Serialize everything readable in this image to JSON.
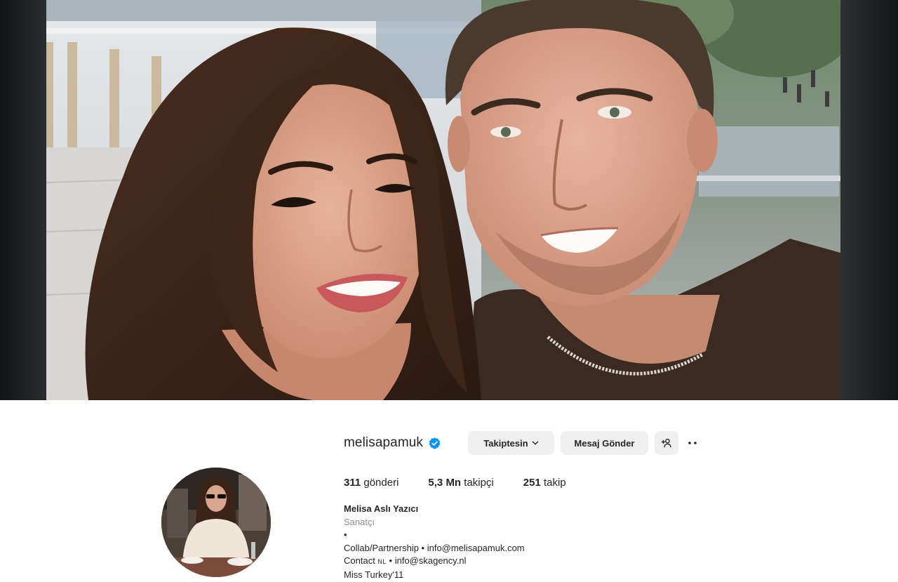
{
  "profile": {
    "username": "melisapamuk",
    "verified_icon": "verified-badge-icon",
    "follow_button_label": "Takiptesin",
    "message_button_label": "Mesaj Gönder",
    "add_user_icon": "add-user-icon",
    "more_icon": "more-options-icon",
    "stats": {
      "posts_count": "311",
      "posts_label": " gönderi",
      "followers_count": "5,3 Mn",
      "followers_label": " takipçi",
      "following_count": "251",
      "following_label": " takip"
    },
    "bio": {
      "full_name": "Melisa Aslı Yazıcı",
      "category": "Sanatçı",
      "bullet": "•",
      "line_collab": "Collab/Partnership • info@melisapamuk.com",
      "contact_prefix": "Contact ",
      "contact_flag": "NL",
      "contact_suffix": " • info@skagency.nl",
      "line_miss": "Miss Turkey'11"
    }
  },
  "colors": {
    "accent_blue": "#0095f6",
    "button_bg": "#efefef",
    "text_primary": "#262626",
    "text_secondary": "#8e8e8e"
  }
}
